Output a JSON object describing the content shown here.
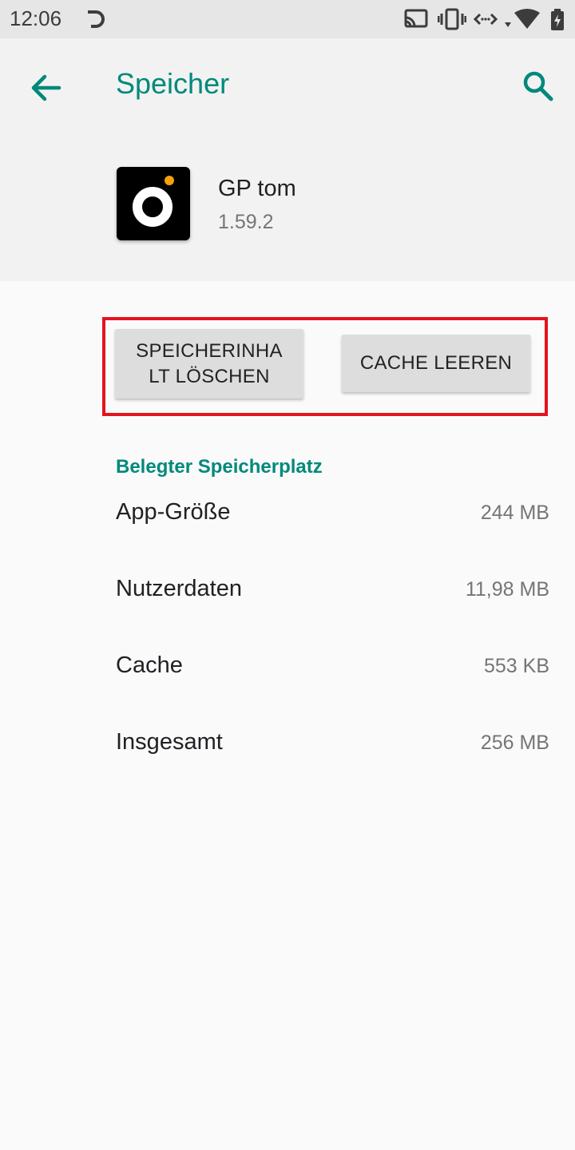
{
  "status_bar": {
    "time": "12:06",
    "icons": [
      "sync-icon",
      "cast-icon",
      "vibrate-icon",
      "data-transfer-icon",
      "wifi-icon",
      "battery-icon"
    ]
  },
  "toolbar": {
    "title": "Speicher",
    "back_icon": "arrow-back-icon",
    "search_icon": "search-icon",
    "accent_color": "#00897b"
  },
  "app": {
    "name": "GP tom",
    "version": "1.59.2"
  },
  "buttons": {
    "clear_storage": "SPEICHERINHA LT LÖSCHEN",
    "clear_storage_line1": "SPEICHERINHA",
    "clear_storage_line2": "LT LÖSCHEN",
    "clear_cache": "CACHE LEEREN"
  },
  "highlight_color": "#e3141e",
  "storage": {
    "section_title": "Belegter Speicherplatz",
    "rows": [
      {
        "label": "App-Größe",
        "value": "244 MB"
      },
      {
        "label": "Nutzerdaten",
        "value": "11,98 MB"
      },
      {
        "label": "Cache",
        "value": "553 KB"
      },
      {
        "label": "Insgesamt",
        "value": "256 MB"
      }
    ]
  }
}
